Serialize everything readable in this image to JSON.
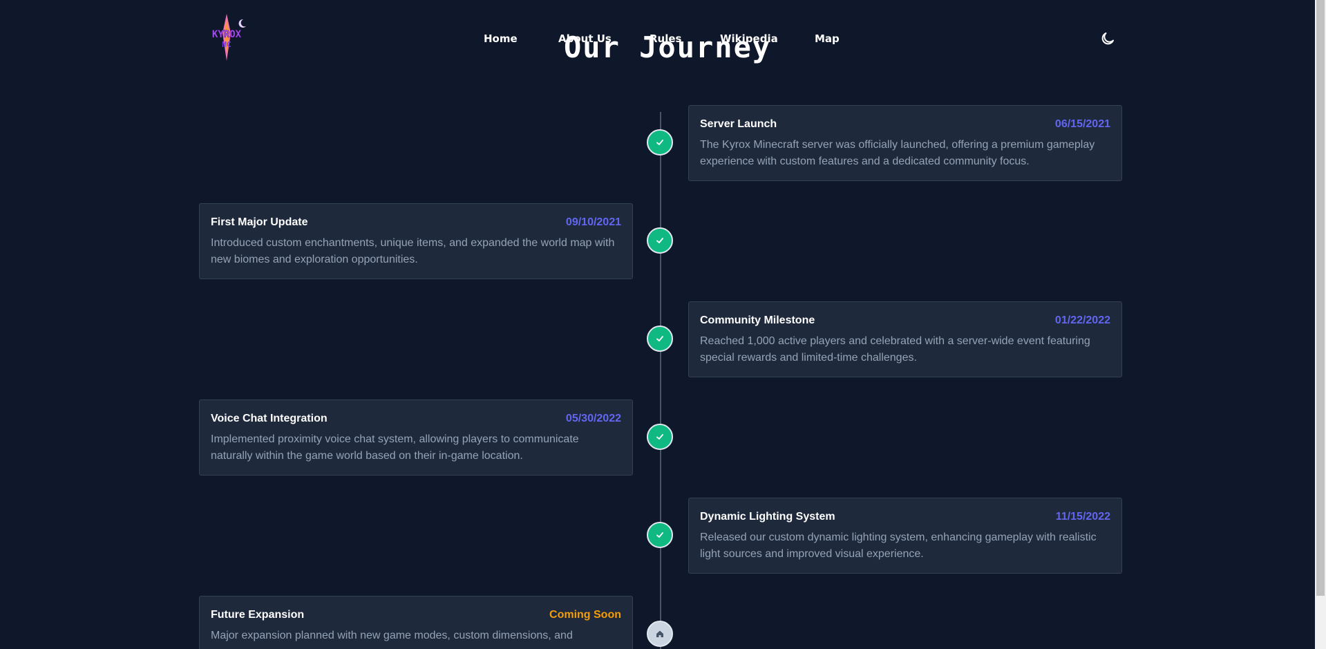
{
  "brand": {
    "logo_text_top": "KYROX",
    "logo_text_bottom": "MC"
  },
  "nav": {
    "items": [
      {
        "label": "Home"
      },
      {
        "label": "About Us"
      },
      {
        "label": "Rules"
      },
      {
        "label": "Wikipedia"
      },
      {
        "label": "Map"
      }
    ]
  },
  "page_title": "Our Journey",
  "colors": {
    "background": "#0f172a",
    "card": "#1e293b",
    "node_done": "#10b981",
    "date": "#6366f1",
    "coming_soon": "#f59e0b"
  },
  "timeline": [
    {
      "title": "Server Launch",
      "date": "06/15/2021",
      "description": "The Kyrox Minecraft server was officially launched, offering a premium gameplay experience with custom features and a dedicated community focus.",
      "icon": "check-icon"
    },
    {
      "title": "First Major Update",
      "date": "09/10/2021",
      "description": "Introduced custom enchantments, unique items, and expanded the world map with new biomes and exploration opportunities.",
      "icon": "check-icon"
    },
    {
      "title": "Community Milestone",
      "date": "01/22/2022",
      "description": "Reached 1,000 active players and celebrated with a server-wide event featuring special rewards and limited-time challenges.",
      "icon": "check-icon"
    },
    {
      "title": "Voice Chat Integration",
      "date": "05/30/2022",
      "description": "Implemented proximity voice chat system, allowing players to communicate naturally within the game world based on their in-game location.",
      "icon": "check-icon"
    },
    {
      "title": "Dynamic Lighting System",
      "date": "11/15/2022",
      "description": "Released our custom dynamic lighting system, enhancing gameplay with realistic light sources and improved visual experience.",
      "icon": "check-icon"
    },
    {
      "title": "Future Expansion",
      "date": "Coming Soon",
      "description": "Major expansion planned with new game modes, custom dimensions, and",
      "icon": "home-icon"
    }
  ]
}
